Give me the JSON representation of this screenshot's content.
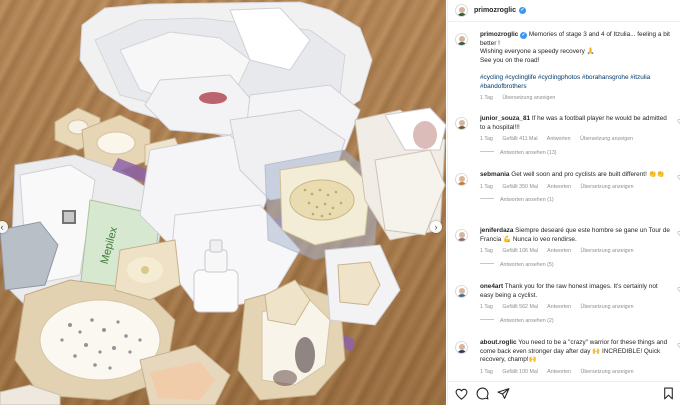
{
  "post": {
    "username": "primozroglic",
    "caption_lines": [
      "Memories of stage 3 and 4 of Itzulia... feeling a bit better !",
      "Wishing everyone a speedy recovery 🙏",
      "See you on the road!"
    ],
    "hashtags": "#cycling #cyclinglife #cyclingphotos #borahansgrohe #itzulia #bandofbrothers",
    "time": "1 Tag",
    "translate_label": "Übersetzung anzeigen"
  },
  "comments": [
    {
      "username": "junior_souza_81",
      "text": "If he was a football player he would be admitted to a hospital!!!",
      "time": "1 Tag",
      "likes": "Gefällt 411 Mal",
      "reply": "Antworten",
      "translate": "Übersetzung anzeigen",
      "view_replies": "Antworten ansehen (13)",
      "avatar_color": "#6a5a3c"
    },
    {
      "username": "sebmania",
      "text": "Get well soon and pro cyclists are built different! 👏👏",
      "time": "1 Tag",
      "likes": "Gefällt 350 Mal",
      "reply": "Antworten",
      "translate": "Übersetzung anzeigen",
      "view_replies": "Antworten ansehen (1)",
      "avatar_color": "#c47a30"
    },
    {
      "username": "jeniferdaza",
      "text": "Siempre desearé que este hombre se gane un Tour de Francia 💪 Nunca lo veo rendirse.",
      "time": "1 Tag",
      "likes": "Gefällt 106 Mal",
      "reply": "Antworten",
      "translate": "Übersetzung anzeigen",
      "view_replies": "Antworten ansehen (5)",
      "avatar_color": "#8a6a7a"
    },
    {
      "username": "one4art",
      "text": "Thank you for the raw honest images. It's certainly not easy being a cyclist.",
      "time": "1 Tag",
      "likes": "Gefällt 562 Mal",
      "reply": "Antworten",
      "translate": "Übersetzung anzeigen",
      "view_replies": "Antworten ansehen (2)",
      "avatar_color": "#4a6a8a"
    },
    {
      "username": "about.roglic",
      "text": "You need to be a \"crazy\" warrior for these things and come back even stronger day after day 🙌 INCREDIBLE! Quick recovery, champ!🙌",
      "time": "1 Tag",
      "likes": "Gefällt 100 Mal",
      "reply": "Antworten",
      "translate": "Übersetzung anzeigen",
      "view_replies": "",
      "avatar_color": "#2a3a5a"
    }
  ],
  "icons": {
    "like": "heart-icon",
    "comment": "comment-icon",
    "share": "share-icon",
    "save": "bookmark-icon",
    "verified": "verified-badge-icon"
  },
  "colors": {
    "link": "#00376b",
    "muted": "#8e8e8e",
    "verified": "#3897f0"
  },
  "photo_packaging_text": {
    "brand": "Mepilex",
    "brand_partial": "Mepil",
    "partial": "Hart"
  }
}
